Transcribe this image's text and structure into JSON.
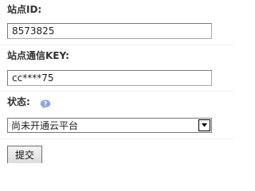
{
  "form": {
    "site_id_label": "站点ID:",
    "site_id_value": "8573825",
    "site_key_label": "站点通信KEY:",
    "site_key_value": "cc****75",
    "status_label": "状态:",
    "help_icon": "help-bubble-icon",
    "status_selected": "尚未开通云平台",
    "submit_label": "提交"
  },
  "colors": {
    "help_icon": "#8fa6d6",
    "border": "#7a7a7a",
    "divider": "#eeeeee"
  }
}
